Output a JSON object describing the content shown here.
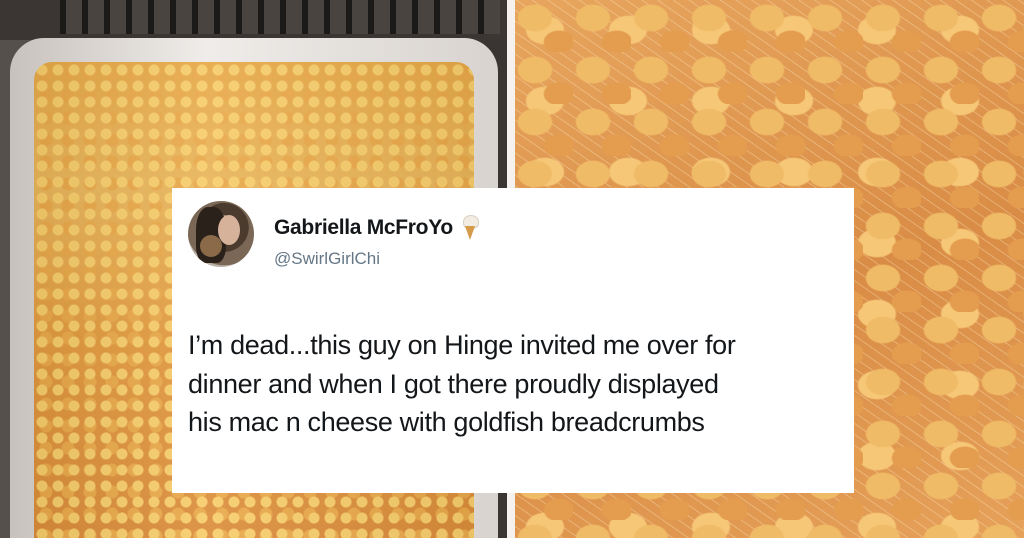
{
  "tweet": {
    "display_name": "Gabriella McFroYo",
    "name_emoji": "ice-cream-icon",
    "handle": "@SwirlGirlChi",
    "text_lines": [
      "I’m dead...this guy on Hinge invited me over for",
      "dinner and when I got there proudly displayed",
      "his mac n cheese with goldfish breadcrumbs"
    ]
  },
  "colors": {
    "tweet_background": "#ffffff",
    "name_color": "#14171a",
    "handle_color": "#657786",
    "divider": "#f4f1ee"
  }
}
